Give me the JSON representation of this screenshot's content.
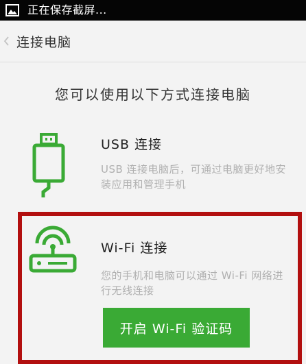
{
  "status_bar": {
    "text": "正在保存截屏...",
    "icon": "gallery-icon"
  },
  "title_bar": {
    "back_icon": "chevron-left-icon",
    "title": "连接电脑"
  },
  "headline": "您可以使用以下方式连接电脑",
  "usb": {
    "icon": "usb-cable-icon",
    "title": "USB 连接",
    "description": "USB 连接电脑后，可通过电脑更好地安装应用和管理手机"
  },
  "wifi": {
    "icon": "wifi-router-icon",
    "title": "Wi-Fi 连接",
    "description": "您的手机和电脑可以通过 Wi-Fi 网络进行无线连接",
    "button_label": "开启 Wi-Fi 验证码"
  },
  "colors": {
    "accent_green": "#3aaa35",
    "highlight_red": "#b20f0f",
    "status_bar": "#050505",
    "background": "#f3f3f3"
  }
}
